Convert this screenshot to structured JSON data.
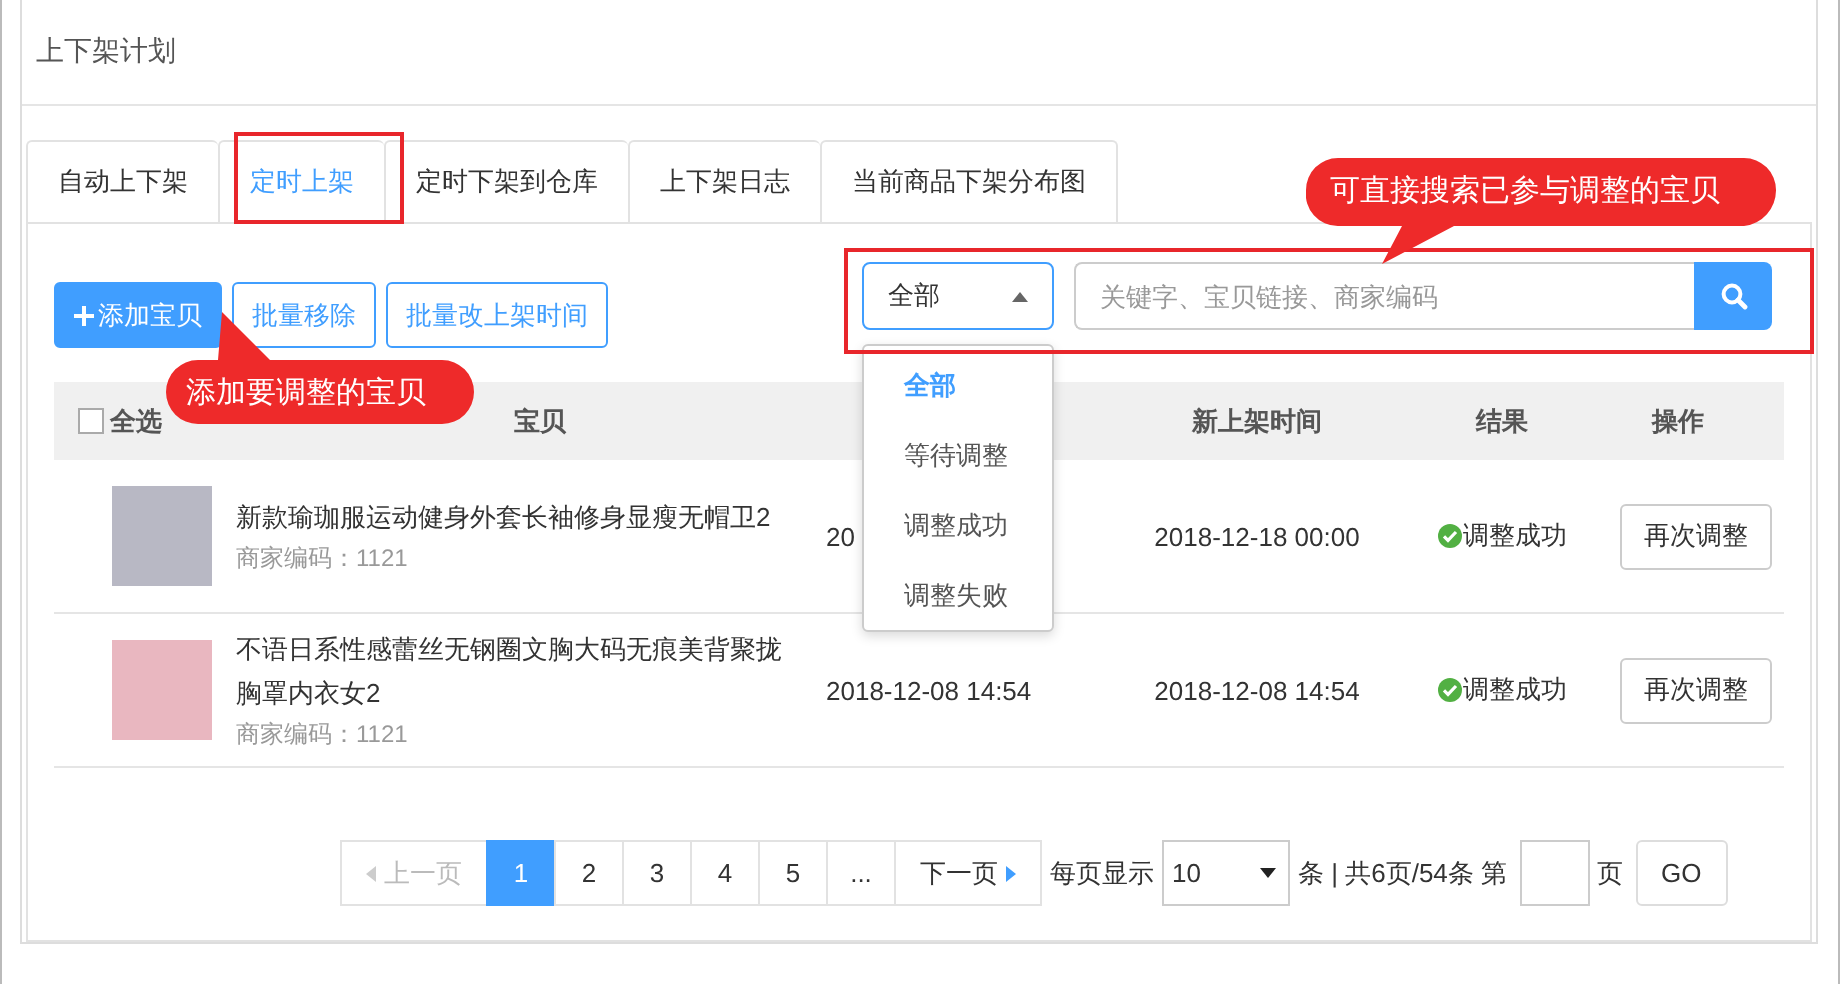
{
  "page_title": "上下架计划",
  "tabs": [
    {
      "label": "自动上下架",
      "selected": false
    },
    {
      "label": "定时上架",
      "selected": true
    },
    {
      "label": "定时下架到仓库",
      "selected": false
    },
    {
      "label": "上下架日志",
      "selected": false
    },
    {
      "label": "当前商品下架分布图",
      "selected": false
    }
  ],
  "toolbar": {
    "buttons": [
      {
        "label": "添加宝贝",
        "kind": "primary"
      },
      {
        "label": "批量移除",
        "kind": "outline"
      },
      {
        "label": "批量改上架时间",
        "kind": "outline"
      }
    ]
  },
  "filter": {
    "value": "全部",
    "expanded": true,
    "options": [
      {
        "label": "全部",
        "selected": true
      },
      {
        "label": "等待调整",
        "selected": false
      },
      {
        "label": "调整成功",
        "selected": false
      },
      {
        "label": "调整失败",
        "selected": false
      }
    ]
  },
  "search": {
    "placeholder": "关键字、宝贝链接、商家编码"
  },
  "table": {
    "select_all": {
      "label": "全选",
      "checked": false
    },
    "columns": {
      "item": "宝贝",
      "new_listing_time": "新上架时间",
      "result": "结果",
      "action": "操作"
    },
    "rows": [
      {
        "title": "新款瑜珈服运动健身外套长袖修身显瘦无帽卫2",
        "code": "商家编码：1121",
        "column_3": "20",
        "new_listing_time": "2018-12-18 00:00",
        "result": "调整成功",
        "succeeded": true,
        "action": "再次调整"
      },
      {
        "title": "不语日系性感蕾丝无钢圈文胸大码无痕美背聚拢胸罩内衣女2",
        "code": "商家编码：1121",
        "column_3": "2018-12-08 14:54",
        "new_listing_time": "2018-12-08 14:54",
        "result": "调整成功",
        "succeeded": true,
        "action": "再次调整"
      }
    ]
  },
  "pagination": {
    "prev": {
      "label": "上一页",
      "disabled": true
    },
    "pages": [
      {
        "label": "1",
        "selected": true
      },
      {
        "label": "2",
        "selected": false
      },
      {
        "label": "3",
        "selected": false
      },
      {
        "label": "4",
        "selected": false
      },
      {
        "label": "5",
        "selected": false
      },
      {
        "label": "...",
        "selected": false
      }
    ],
    "next": {
      "label": "下一页",
      "disabled": false
    },
    "per_page_label": "每页显示",
    "per_page": "10",
    "summary": "条 | 共6页/54条 第",
    "page_suffix": "页",
    "go": "GO"
  },
  "annotations": [
    {
      "text": "添加要调整的宝贝",
      "kind": "pointer-up"
    },
    {
      "text": "可直接搜索已参与调整的宝贝",
      "kind": "pointer-down"
    }
  ]
}
